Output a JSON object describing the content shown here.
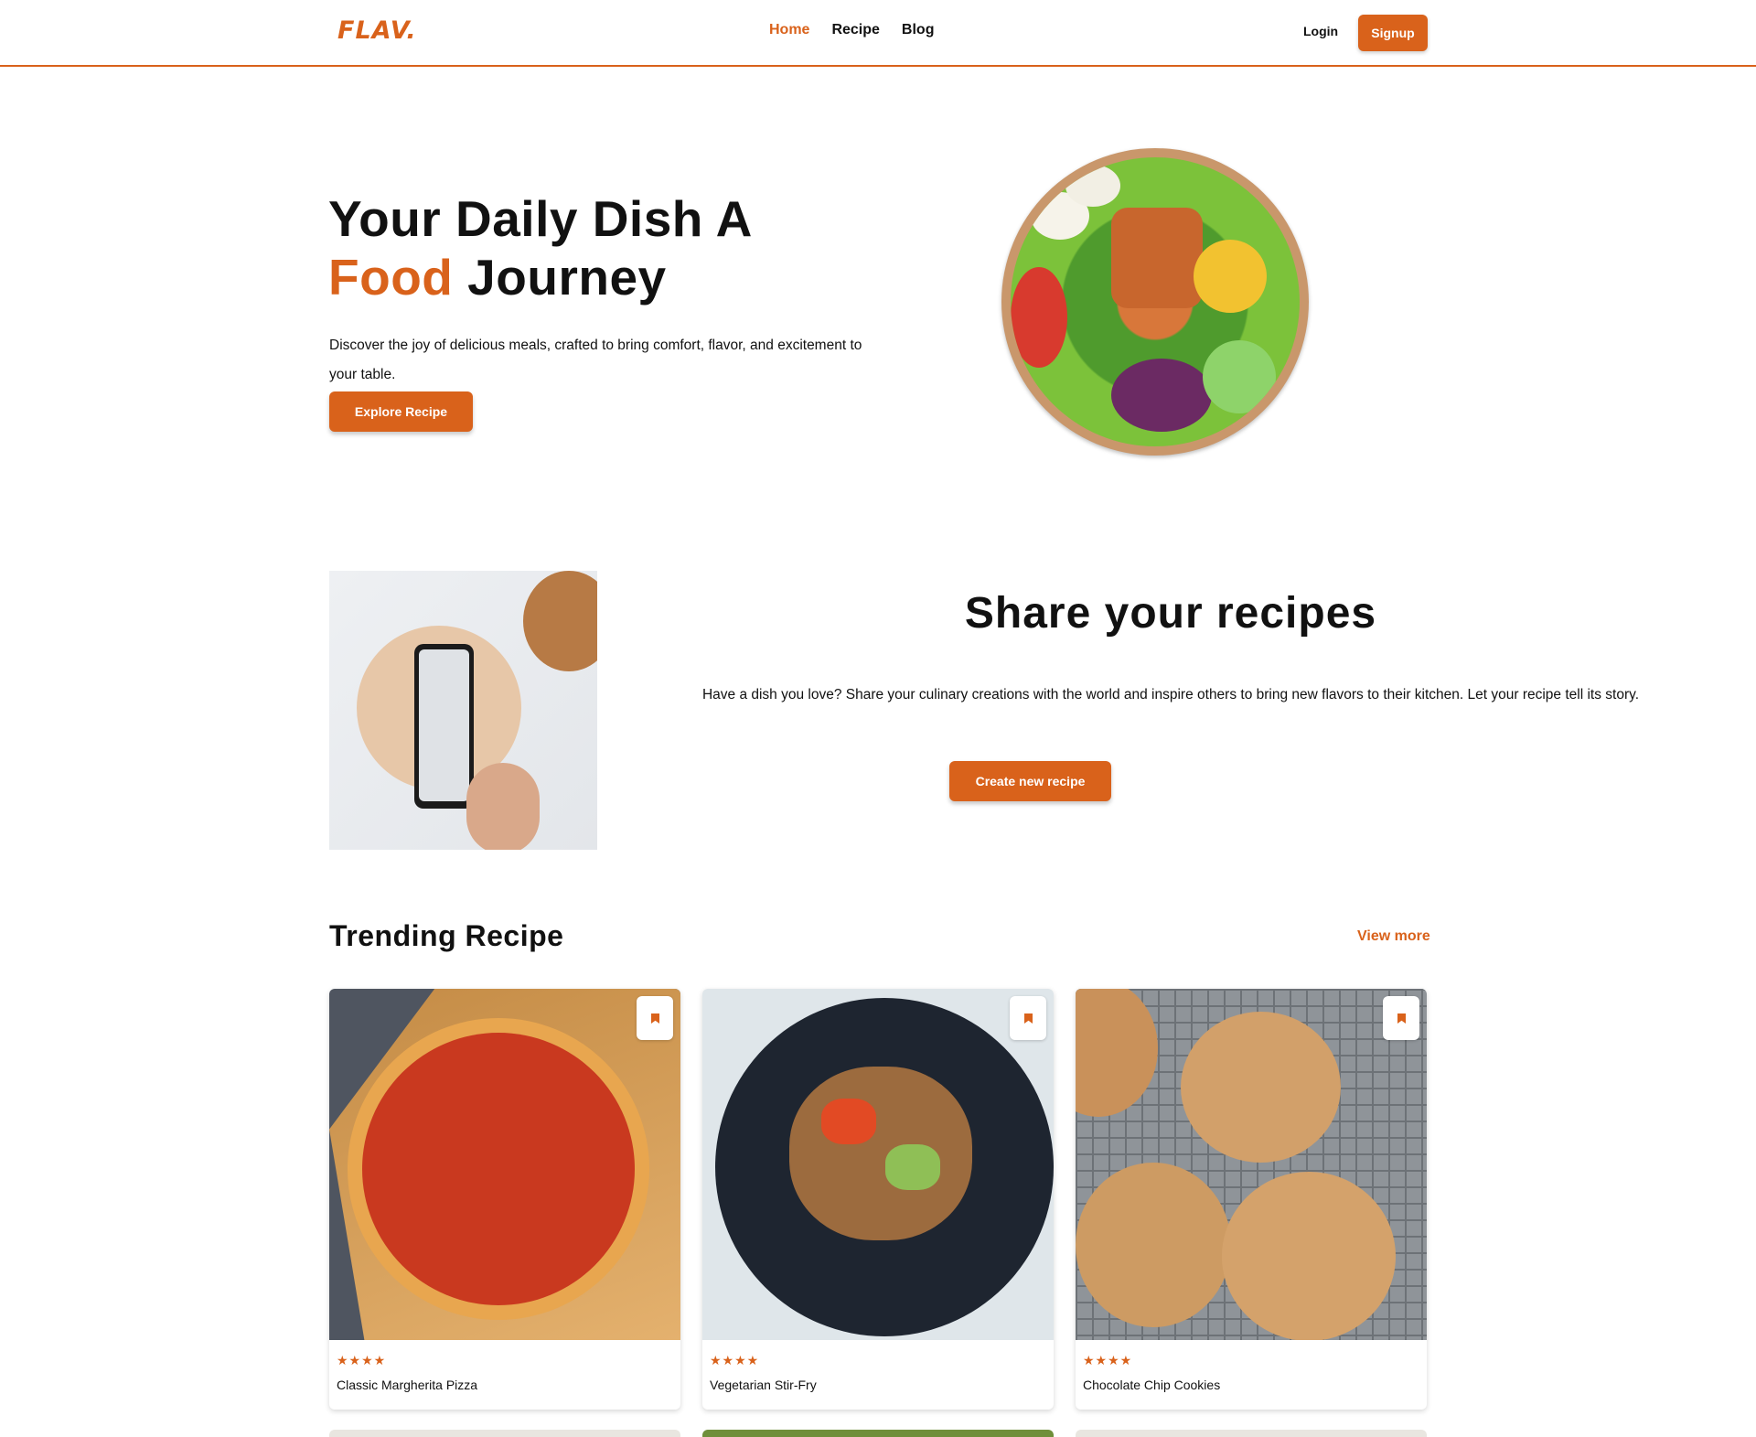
{
  "nav": {
    "logo": "FLAV.",
    "links": [
      "Home",
      "Recipe",
      "Blog"
    ],
    "login": "Login",
    "signup": "Signup"
  },
  "hero": {
    "title_line1": "Your Daily Dish A",
    "title_accent": "Food",
    "title_rest": " Journey",
    "description": "Discover the joy of delicious meals, crafted to bring comfort, flavor, and excitement to your table.",
    "button": "Explore Recipe"
  },
  "share": {
    "title": "Share your recipes",
    "description": "Have a dish you love? Share your culinary creations with the world and inspire others to bring new flavors to their kitchen. Let your recipe tell its story.",
    "button": "Create new recipe"
  },
  "trending": {
    "title": "Trending Recipe",
    "view_more": "View more",
    "cards": [
      {
        "name": "Classic Margherita Pizza",
        "stars": "★★★★",
        "rating": 4
      },
      {
        "name": "Vegetarian Stir-Fry",
        "stars": "★★★★",
        "rating": 4
      },
      {
        "name": "Chocolate Chip Cookies",
        "stars": "★★★★",
        "rating": 4
      }
    ]
  },
  "colors": {
    "accent": "#d9621b",
    "text": "#111111",
    "background": "#ffffff"
  },
  "icons": [
    "bookmark-icon",
    "star-icon"
  ]
}
